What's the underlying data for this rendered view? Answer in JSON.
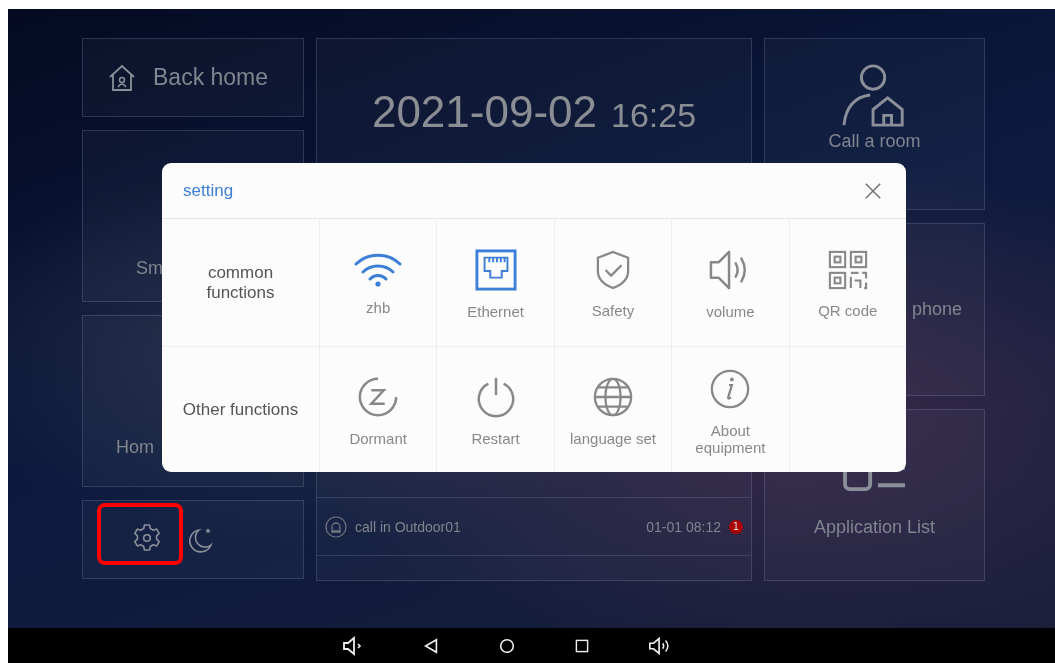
{
  "home_tiles": {
    "back_home": "Back home",
    "smart_partial": "Sm",
    "home_partial": "Hom",
    "phone_partial": "phone",
    "call_room": "Call a room",
    "app_list": "Application List"
  },
  "clock": {
    "date": "2021-09-02",
    "time": "16:25"
  },
  "call_log": [
    {
      "text": "call in Outdoor01",
      "time": "01-01 08:12",
      "badge": "1"
    }
  ],
  "dialog": {
    "title": "setting",
    "sections": [
      {
        "label": "common functions",
        "items": [
          {
            "kind": "wifi",
            "label": "zhb",
            "active": true
          },
          {
            "kind": "ethernet",
            "label": "Ethernet",
            "active": true
          },
          {
            "kind": "shield",
            "label": "Safety",
            "active": false
          },
          {
            "kind": "volume",
            "label": "volume",
            "active": false
          },
          {
            "kind": "qr",
            "label": "QR code",
            "active": false
          }
        ]
      },
      {
        "label": "Other functions",
        "items": [
          {
            "kind": "sleep",
            "label": "Dormant",
            "active": false
          },
          {
            "kind": "power",
            "label": "Restart",
            "active": false
          },
          {
            "kind": "globe",
            "label": "language set",
            "active": false
          },
          {
            "kind": "info",
            "label": "About equipment",
            "active": false
          }
        ]
      }
    ]
  }
}
